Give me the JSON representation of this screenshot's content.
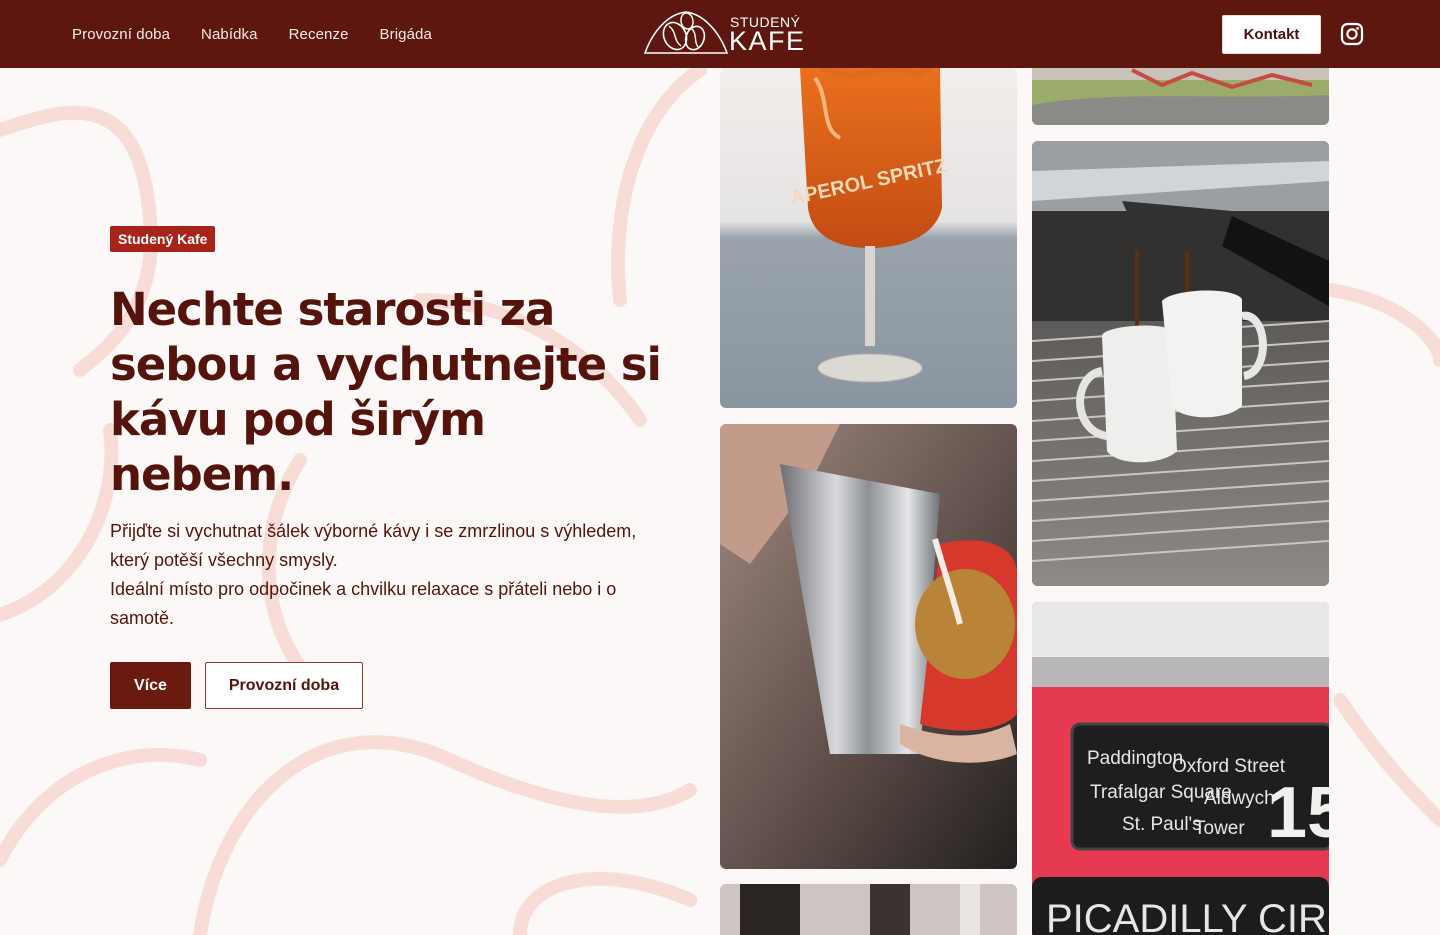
{
  "nav": {
    "items": [
      "Provozní doba",
      "Nabídka",
      "Recenze",
      "Brigáda"
    ]
  },
  "logo": {
    "top": "STUDENÝ",
    "main": "KAFE"
  },
  "header": {
    "contact_label": "Kontakt",
    "instagram_icon": "instagram-icon"
  },
  "hero": {
    "badge": "Studený Kafe",
    "title": "Nechte starosti za sebou a vychutnejte si kávu pod širým nebem.",
    "description_line1": "Přijďte si vychutnat šálek výborné kávy i se zmrzlinou s výhledem, který potěší všechny smysly.",
    "description_line2": "Ideální místo pro odpočinek a chvilku relaxace s přáteli nebo i o samotě.",
    "more_label": "Více",
    "hours_label": "Provozní doba"
  },
  "gallery": {
    "aperol_text": "APEROL SPRITZ",
    "bus_sign": [
      "Paddington",
      "Oxford Street",
      "Trafalgar Square",
      "Aldwych",
      "St. Paul's",
      "Tower"
    ],
    "bus_number": "15",
    "bus_bottom": "PICADILLY CIRC"
  },
  "colors": {
    "brand": "#5e170e",
    "accent": "#a8241a",
    "background": "#fdf8f8"
  }
}
